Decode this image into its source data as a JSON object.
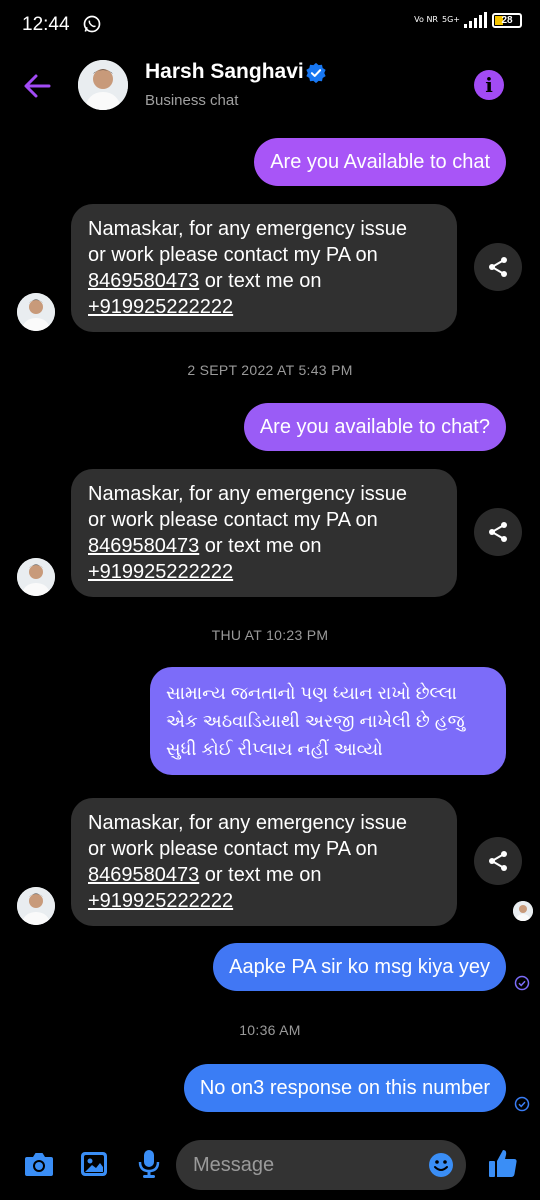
{
  "status_bar": {
    "time": "12:44",
    "net_top": "5G+",
    "net_bottom": "Vo NR",
    "battery": "28"
  },
  "header": {
    "name": "Harsh Sanghavi",
    "subtitle": "Business chat"
  },
  "messages": {
    "m1": "Are you Available to chat",
    "auto1": {
      "line1": "Namaskar, for any emergency issue",
      "line2": "or work please contact my PA  on",
      "phone1": "8469580473",
      "mid": " or text me on",
      "phone2": "+919925222222"
    },
    "ts1": "2 SEPT 2022 AT 5:43 PM",
    "m2": "Are you available to chat?",
    "auto2": {
      "line1": "Namaskar, for any emergency issue",
      "line2": "or work please contact my PA  on",
      "phone1": "8469580473",
      "mid": " or text me on",
      "phone2": "+919925222222"
    },
    "ts2": "THU AT 10:23 PM",
    "m3": {
      "line1": "સામાન્ય જનતાનો પણ ધ્યાન રાખો છેલ્લા",
      "line2": "એક અઠવાડિયાથી અરજી નાખેલી છે હજુ",
      "line3": "સુધી કોઈ રીપ્લાય નહીં આવ્યો"
    },
    "auto3": {
      "line1": "Namaskar, for any emergency issue",
      "line2": "or work please contact my PA  on",
      "phone1": "8469580473",
      "mid": " or text me on",
      "phone2": "+919925222222"
    },
    "m4": "Aapke PA sir ko msg kiya yey",
    "ts3": "10:36 AM",
    "m5": "No on3 response on this number"
  },
  "composer": {
    "placeholder": "Message"
  },
  "colors": {
    "purple_bubble": "#a855f7",
    "violet_bubble": "#7c6cf9",
    "blue_bubble": "#3a7df5",
    "incoming_bubble": "#303030",
    "accent": "#a24bf5",
    "composer_icons": "#3a8ef6"
  },
  "icons": [
    "whatsapp-icon",
    "back-arrow-icon",
    "verified-icon",
    "info-icon",
    "share-icon",
    "read-receipt-icon",
    "camera-icon",
    "gallery-icon",
    "microphone-icon",
    "emoji-icon",
    "thumbs-up-icon"
  ]
}
